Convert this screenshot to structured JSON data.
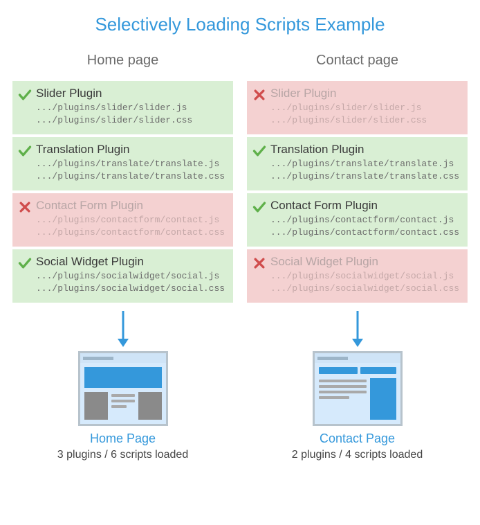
{
  "title": "Selectively Loading Scripts Example",
  "plugins": [
    {
      "name": "Slider Plugin",
      "files": [
        ".../plugins/slider/slider.js",
        ".../plugins/slider/slider.css"
      ]
    },
    {
      "name": "Translation Plugin",
      "files": [
        ".../plugins/translate/translate.js",
        ".../plugins/translate/translate.css"
      ]
    },
    {
      "name": "Contact Form Plugin",
      "files": [
        ".../plugins/contactform/contact.js",
        ".../plugins/contactform/contact.css"
      ]
    },
    {
      "name": "Social Widget Plugin",
      "files": [
        ".../plugins/socialwidget/social.js",
        ".../plugins/socialwidget/social.css"
      ]
    }
  ],
  "columns": [
    {
      "header": "Home page",
      "page_label": "Home Page",
      "stats": "3 plugins / 6 scripts loaded",
      "mock_type": "home",
      "enabled": [
        true,
        true,
        false,
        true
      ]
    },
    {
      "header": "Contact page",
      "page_label": "Contact Page",
      "stats": "2 plugins / 4 scripts loaded",
      "mock_type": "contact",
      "enabled": [
        false,
        true,
        true,
        false
      ]
    }
  ],
  "colors": {
    "check": "#5fb04a",
    "cross": "#d04c4c",
    "accent": "#3498db"
  }
}
